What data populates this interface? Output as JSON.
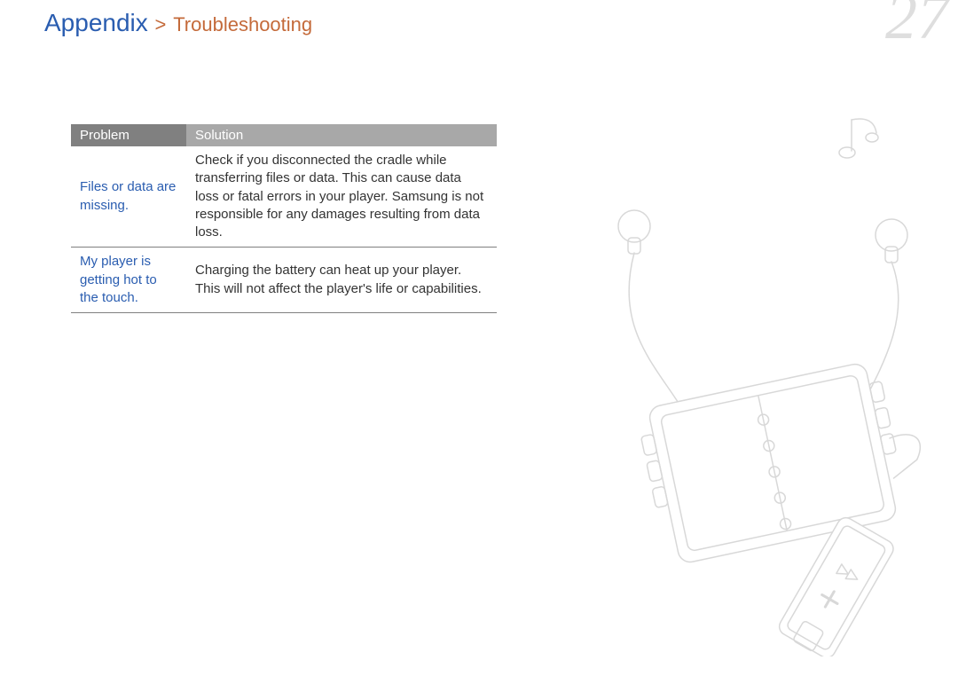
{
  "header": {
    "section": "Appendix",
    "separator": ">",
    "subsection": "Troubleshooting"
  },
  "page_number": "27",
  "table": {
    "headers": {
      "problem": "Problem",
      "solution": "Solution"
    },
    "rows": [
      {
        "problem": "Files or data are missing.",
        "solution": "Check if you disconnected the cradle while transferring files or data. This can cause data loss or fatal errors in your player. Samsung is not responsible for any damages resulting from data loss."
      },
      {
        "problem": "My player is getting hot to the touch.",
        "solution": "Charging the battery can heat up your player. This will not affect the player's life or capabilities."
      }
    ]
  }
}
